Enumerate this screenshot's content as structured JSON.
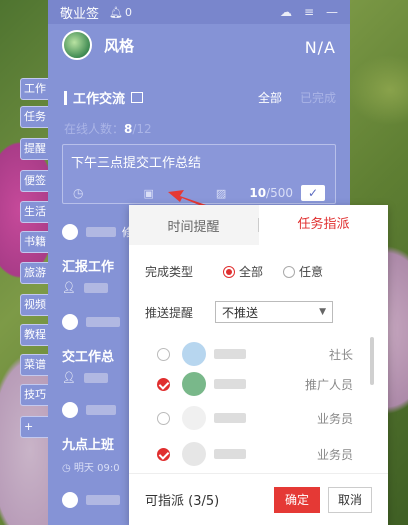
{
  "app": {
    "title": "敬业签",
    "bell_count": "0"
  },
  "profile": {
    "name": "风格",
    "code": "N/A"
  },
  "section": {
    "title": "工作交流",
    "filter_all": "全部",
    "filter_done": "已完成"
  },
  "online": {
    "label": "在线人数：",
    "count": "8",
    "total": "/12"
  },
  "input": {
    "text": "下午三点提交工作总结",
    "count": "10",
    "limit": "/500",
    "confirm": "✓"
  },
  "sidebar": {
    "items": [
      {
        "label": "工作"
      },
      {
        "label": "任务"
      },
      {
        "label": "提醒"
      },
      {
        "label": "便签"
      },
      {
        "label": "生活"
      },
      {
        "label": "书籍"
      },
      {
        "label": "旅游"
      },
      {
        "label": "视频"
      },
      {
        "label": "教程"
      },
      {
        "label": "菜谱"
      },
      {
        "label": "技巧"
      },
      {
        "label": "+"
      }
    ]
  },
  "feed": [
    {
      "suffix": "修"
    },
    {
      "title": "汇报工作"
    },
    {
      "title": "交工作总"
    },
    {
      "title": "九点上班"
    },
    {
      "time": "明天 09:0"
    }
  ],
  "popup": {
    "tabs": [
      {
        "label": "时间提醒"
      },
      {
        "label": "任务指派"
      }
    ],
    "type_label": "完成类型",
    "type_all": "全部",
    "type_any": "任意",
    "push_label": "推送提醒",
    "push_value": "不推送",
    "people": [
      {
        "role": "社长",
        "checked": false
      },
      {
        "role": "推广人员",
        "checked": true
      },
      {
        "role": "业务员",
        "checked": false
      },
      {
        "role": "业务员",
        "checked": true
      }
    ],
    "footer": {
      "label": "可指派 (3/5)",
      "ok": "确定",
      "cancel": "取消"
    }
  }
}
